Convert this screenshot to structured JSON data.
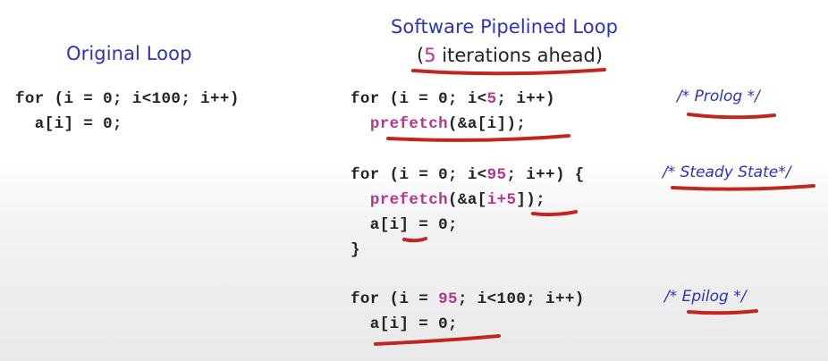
{
  "original": {
    "title": "Original Loop",
    "line1": "for (i = 0; i<100; i++)",
    "line2": "  a[i] = 0;"
  },
  "pipelined": {
    "title": "Software Pipelined Loop",
    "subtitle_open": "(",
    "subtitle_num": "5",
    "subtitle_rest": " iterations ahead)",
    "prolog": {
      "l1_a": "for (i = 0; i<",
      "l1_num": "5",
      "l1_b": "; i++)",
      "l2_indent": "  ",
      "l2_kw": "prefetch",
      "l2_rest": "(&a[i]);",
      "comment": "/* Prolog */"
    },
    "steady": {
      "l1_a": "for (i = 0; i<",
      "l1_num": "95",
      "l1_b": "; i++) {",
      "l2_indent": "  ",
      "l2_kw": "prefetch",
      "l2_a": "(&a[",
      "l2_hl": "i+5",
      "l2_b": "]);",
      "l3": "  a[i] = 0;",
      "l4": "}",
      "comment": "/* Steady State*/"
    },
    "epilog": {
      "l1_a": "for (i = ",
      "l1_num": "95",
      "l1_b": "; i<100; i++)",
      "l2": "  a[i] = 0;",
      "comment": "/* Epilog */"
    }
  },
  "colors": {
    "heading": "#2f33b5",
    "highlight": "#b3358f",
    "annotation": "#c0281f"
  }
}
